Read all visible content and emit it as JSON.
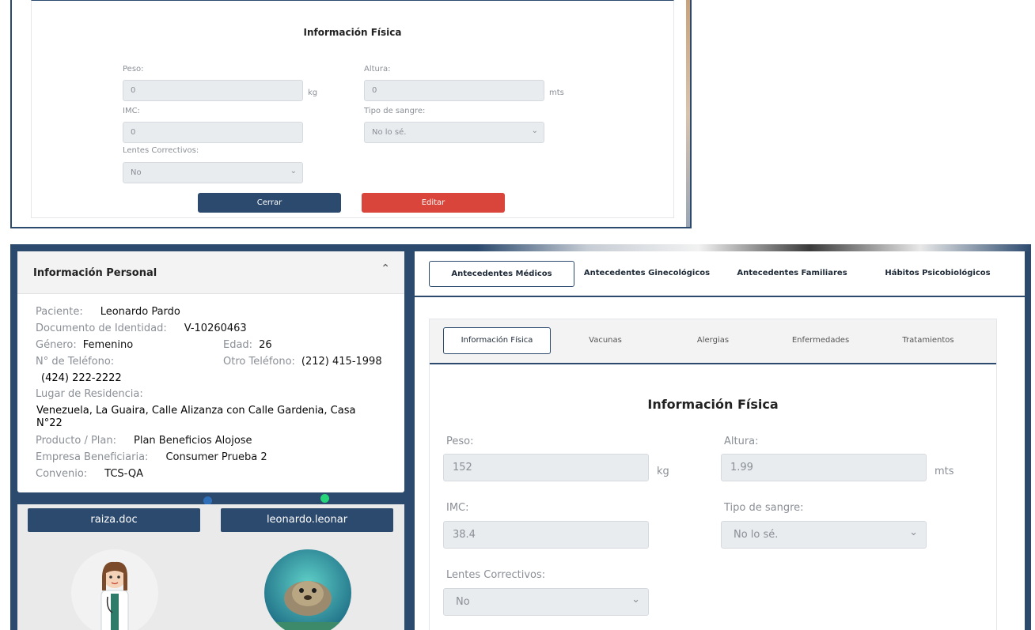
{
  "top": {
    "title": "Información Física",
    "peso_label": "Peso:",
    "peso_value": "0",
    "peso_unit": "kg",
    "altura_label": "Altura:",
    "altura_value": "0",
    "altura_unit": "mts",
    "imc_label": "IMC:",
    "imc_value": "0",
    "sangre_label": "Tipo de sangre:",
    "sangre_value": "No lo sé.",
    "lentes_label": "Lentes Correctivos:",
    "lentes_value": "No",
    "cerrar": "Cerrar",
    "editar": "Editar"
  },
  "personal": {
    "title": "Información Personal",
    "paciente_label": "Paciente:",
    "paciente": "Leonardo Pardo",
    "documento_label": "Documento de Identidad:",
    "documento": "V-10260463",
    "genero_label": "Género:",
    "genero": "Femenino",
    "edad_label": "Edad:",
    "edad": "26",
    "telefono_label": "N° de Teléfono:",
    "telefono": "(424) 222-2222",
    "otro_label": "Otro Teléfono:",
    "otro": "(212) 415-1998",
    "residencia_label": "Lugar de Residencia:",
    "residencia": "Venezuela, La Guaira, Calle Alizanza con Calle Gardenia, Casa N°22",
    "plan_label": "Producto / Plan:",
    "plan": "Plan Beneficios Alojose",
    "empresa_label": "Empresa Beneficiaria:",
    "empresa": "Consumer Prueba 2",
    "convenio_label": "Convenio:",
    "convenio": "TCS-QA"
  },
  "users": {
    "doctor": "raiza.doc",
    "patient": "leonardo.leonar"
  },
  "tabs": [
    "Antecedentes Médicos",
    "Antecedentes Ginecológicos",
    "Antecedentes Familiares",
    "Hábitos Psicobiológicos"
  ],
  "inner_tabs": [
    "Información Física",
    "Vacunas",
    "Alergias",
    "Enfermedades",
    "Tratamientos"
  ],
  "fisica": {
    "title": "Información Física",
    "peso_label": "Peso:",
    "peso_value": "152",
    "peso_unit": "kg",
    "altura_label": "Altura:",
    "altura_value": "1.99",
    "altura_unit": "mts",
    "imc_label": "IMC:",
    "imc_value": "38.4",
    "sangre_label": "Tipo de sangre:",
    "sangre_value": "No lo sé.",
    "lentes_label": "Lentes Correctivos:",
    "lentes_value": "No"
  },
  "colors": {
    "primary": "#2c4a6e",
    "danger": "#d9453a"
  }
}
